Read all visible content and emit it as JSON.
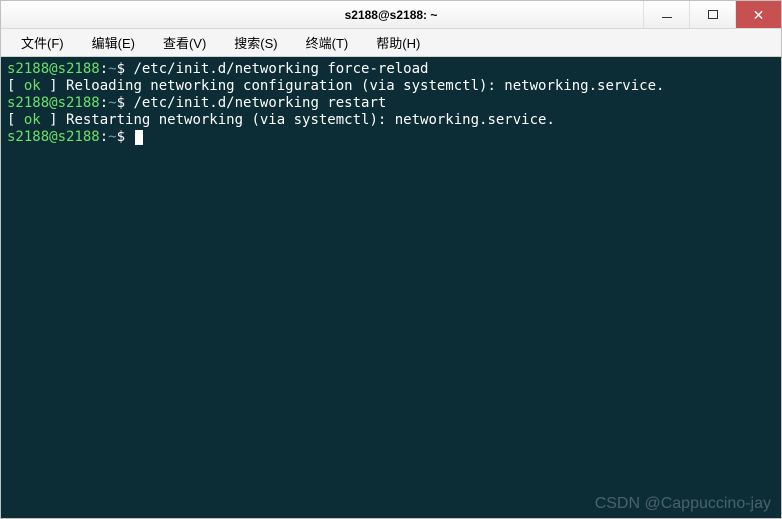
{
  "window": {
    "title": "s2188@s2188: ~"
  },
  "menu": {
    "file": "文件(F)",
    "edit": "编辑(E)",
    "view": "查看(V)",
    "search": "搜索(S)",
    "terminal": "终端(T)",
    "help": "帮助(H)"
  },
  "terminal": {
    "prompt_user": "s2188@s2188",
    "prompt_colon": ":",
    "prompt_tilde": "~",
    "prompt_dollar": "$ ",
    "lines": {
      "cmd1": "/etc/init.d/networking force-reload",
      "bracket_open": "[ ",
      "ok": "ok",
      "bracket_close": " ] ",
      "msg1": "Reloading networking configuration (via systemctl): networking.service.",
      "cmd2": "/etc/init.d/networking restart",
      "msg2": "Restarting networking (via systemctl): networking.service."
    }
  },
  "watermark": "CSDN @Cappuccino-jay"
}
